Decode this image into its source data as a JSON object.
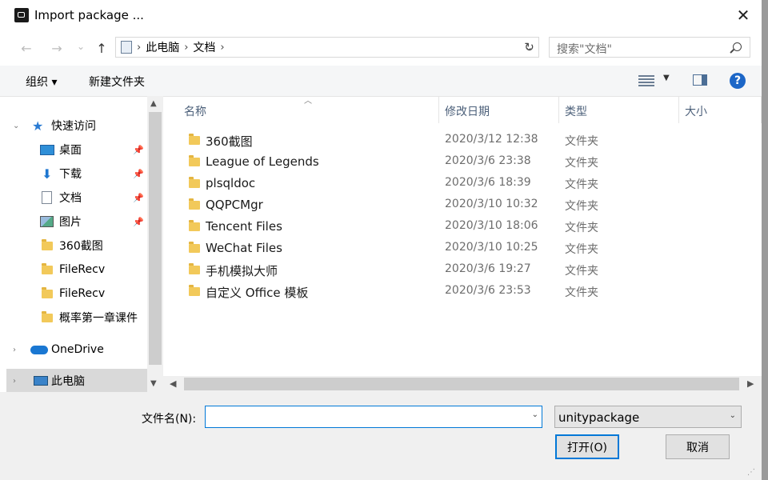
{
  "window": {
    "title": "Import package ...",
    "close": "✕"
  },
  "nav": {
    "back": "←",
    "forward": "→",
    "recent": "⌄",
    "up": "↑",
    "refresh": "↻"
  },
  "address": {
    "crumbs": [
      "此电脑",
      "文档"
    ],
    "sep": "›"
  },
  "search": {
    "placeholder": "搜索\"文档\""
  },
  "toolbar": {
    "organize": "组织 ▾",
    "new_folder": "新建文件夹",
    "help": "?"
  },
  "sidebar": {
    "items": [
      {
        "label": "快速访问",
        "pinned": false
      },
      {
        "label": "桌面",
        "pinned": true
      },
      {
        "label": "下载",
        "pinned": true
      },
      {
        "label": "文档",
        "pinned": true
      },
      {
        "label": "图片",
        "pinned": true
      },
      {
        "label": "360截图"
      },
      {
        "label": "FileRecv"
      },
      {
        "label": "FileRecv"
      },
      {
        "label": "概率第一章课件"
      },
      {
        "label": "OneDrive"
      },
      {
        "label": "此电脑"
      }
    ]
  },
  "columns": {
    "name": "名称",
    "date": "修改日期",
    "type": "类型",
    "size": "大小"
  },
  "files": [
    {
      "name": "360截图",
      "date": "2020/3/12 12:38",
      "type": "文件夹"
    },
    {
      "name": "League of Legends",
      "date": "2020/3/6 23:38",
      "type": "文件夹"
    },
    {
      "name": "plsqldoc",
      "date": "2020/3/6 18:39",
      "type": "文件夹"
    },
    {
      "name": "QQPCMgr",
      "date": "2020/3/10 10:32",
      "type": "文件夹"
    },
    {
      "name": "Tencent Files",
      "date": "2020/3/10 18:06",
      "type": "文件夹"
    },
    {
      "name": "WeChat Files",
      "date": "2020/3/10 10:25",
      "type": "文件夹"
    },
    {
      "name": "手机模拟大师",
      "date": "2020/3/6 19:27",
      "type": "文件夹"
    },
    {
      "name": "自定义 Office 模板",
      "date": "2020/3/6 23:53",
      "type": "文件夹"
    }
  ],
  "bottom": {
    "filename_label": "文件名(N):",
    "filename_value": "",
    "filetype": "unitypackage",
    "open": "打开(O)",
    "cancel": "取消"
  },
  "colors": {
    "accent": "#0078d7",
    "selected": "#cce8ff",
    "folder": "#f2c95a"
  }
}
